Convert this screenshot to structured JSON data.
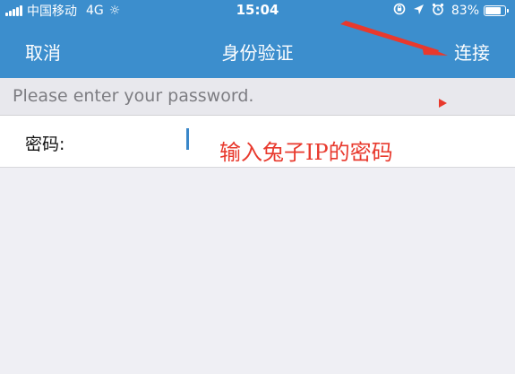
{
  "status_bar": {
    "carrier": "中国移动",
    "network": "4G",
    "time": "15:04",
    "battery_percent": "83%",
    "battery_level": 0.83,
    "icons": [
      "signal-icon",
      "activity-icon",
      "lock-rotation-icon",
      "location-icon",
      "alarm-icon",
      "battery-icon"
    ]
  },
  "nav": {
    "cancel_label": "取消",
    "title": "身份验证",
    "connect_label": "连接"
  },
  "hint": "Please enter your password.",
  "form": {
    "password_label": "密码:",
    "password_value": ""
  },
  "annotation": {
    "text": "输入兔子IP的密码",
    "color": "#e8392d"
  },
  "colors": {
    "nav_background": "#3c8ecd",
    "page_background": "#efeff4",
    "annotation_red": "#e8392d"
  }
}
